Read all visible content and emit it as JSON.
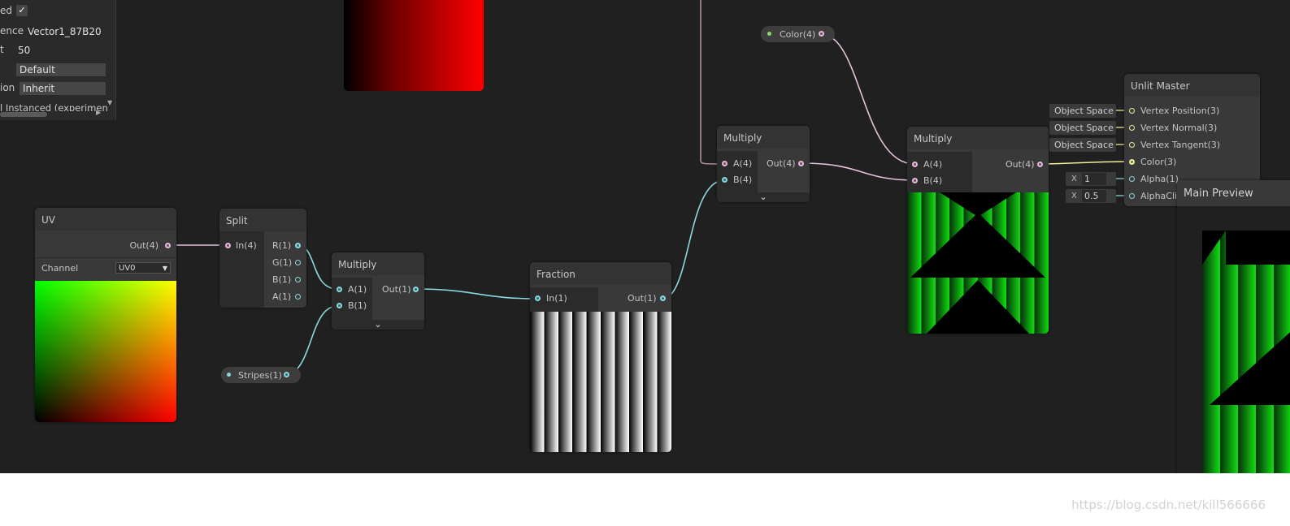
{
  "inspector": {
    "rows": [
      {
        "label": "ed",
        "value": "",
        "check": "✓"
      },
      {
        "label": "ence",
        "value": "Vector1_87B20"
      },
      {
        "label": "t",
        "value": "50"
      },
      {
        "label": "",
        "value": "Default"
      },
      {
        "label": "ion",
        "value": "Inherit"
      }
    ],
    "instanced_label": "l Instanced (experimen"
  },
  "nodes": {
    "uv": {
      "title": "UV",
      "out": "Out(4)",
      "channel_label": "Channel",
      "channel_value": "UV0"
    },
    "split": {
      "title": "Split",
      "in": "In(4)",
      "outs": [
        "R(1)",
        "G(1)",
        "B(1)",
        "A(1)"
      ]
    },
    "multiply1": {
      "title": "Multiply",
      "a": "A(1)",
      "b": "B(1)",
      "out": "Out(1)"
    },
    "stripes": {
      "label": "Stripes(1)"
    },
    "fraction": {
      "title": "Fraction",
      "in": "In(1)",
      "out": "Out(1)"
    },
    "multiply2": {
      "title": "Multiply",
      "a": "A(4)",
      "b": "B(4)",
      "out": "Out(4)"
    },
    "color_prop": {
      "label": "Color(4)"
    },
    "multiply3": {
      "title": "Multiply",
      "a": "A(4)",
      "b": "B(4)",
      "out": "Out(4)"
    },
    "master": {
      "title": "Unlit Master",
      "ports": [
        "Vertex Position(3)",
        "Vertex Normal(3)",
        "Vertex Tangent(3)",
        "Color(3)",
        "Alpha(1)",
        "AlphaClip"
      ],
      "space_tags": [
        "Object Space",
        "Object Space",
        "Object Space"
      ],
      "alpha_x": "X",
      "alpha_value": "1",
      "clip_x": "X",
      "clip_value": "0.5"
    }
  },
  "main_preview": {
    "title": "Main Preview"
  },
  "watermark": "https://blog.csdn.net/kill566666",
  "colors": {
    "background": "#202020",
    "node": "#393939",
    "wire_pink": "#e6c1dc",
    "wire_cyan": "#8ad8e0",
    "wire_yellow": "#f0ee9a",
    "preview_green": "#11dd11"
  }
}
